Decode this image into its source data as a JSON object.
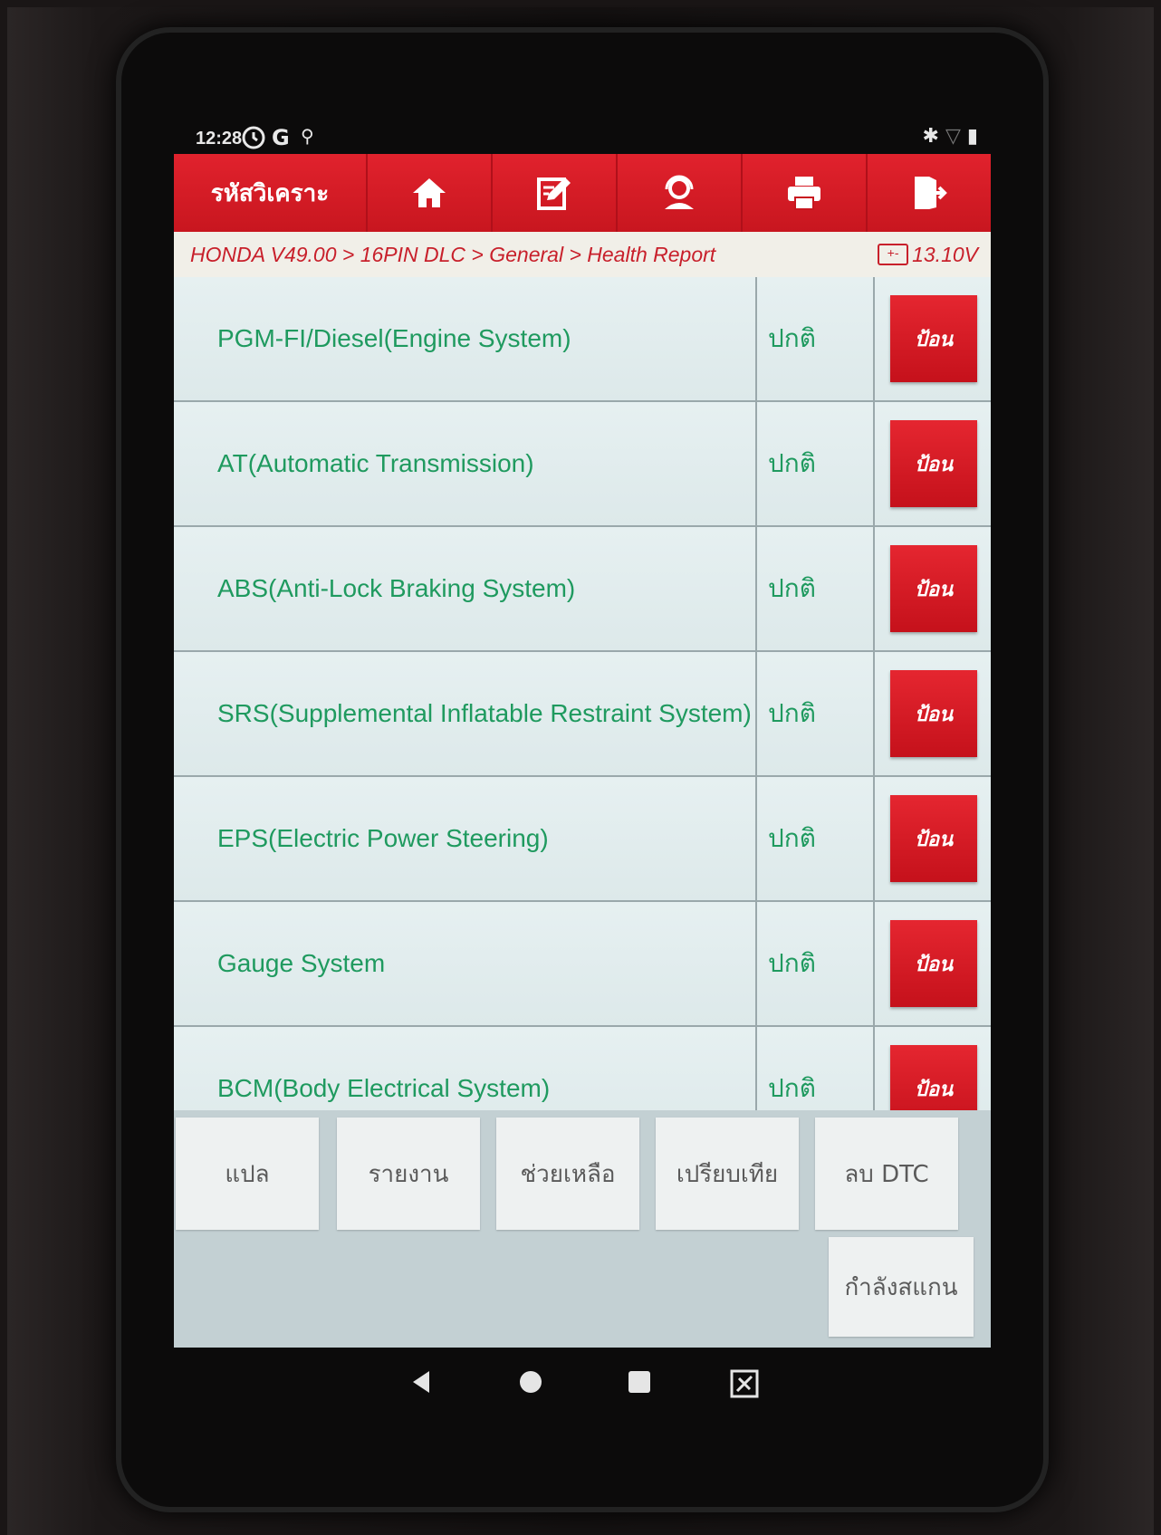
{
  "status_bar": {
    "time": "12:28",
    "icons": [
      "alarm-icon",
      "google-icon",
      "usb-debug-icon"
    ],
    "right_icons": [
      "bluetooth-icon",
      "wifi-icon",
      "battery-icon"
    ]
  },
  "toolbar": {
    "title": "รหัสวิเคราะ",
    "buttons": [
      "home-icon",
      "edit-icon",
      "support-icon",
      "print-icon",
      "exit-icon"
    ]
  },
  "breadcrumb": {
    "path": "HONDA V49.00 > 16PIN DLC > General > Health Report",
    "voltage": "13.10V"
  },
  "systems": [
    {
      "name": "PGM-FI/Diesel(Engine System)",
      "status": "ปกติ",
      "action": "ป้อน"
    },
    {
      "name": "AT(Automatic Transmission)",
      "status": "ปกติ",
      "action": "ป้อน"
    },
    {
      "name": "ABS(Anti-Lock Braking System)",
      "status": "ปกติ",
      "action": "ป้อน"
    },
    {
      "name": "SRS(Supplemental Inflatable Restraint System)",
      "status": "ปกติ",
      "action": "ป้อน"
    },
    {
      "name": "EPS(Electric Power Steering)",
      "status": "ปกติ",
      "action": "ป้อน"
    },
    {
      "name": "Gauge System",
      "status": "ปกติ",
      "action": "ป้อน"
    },
    {
      "name": "BCM(Body Electrical System)",
      "status": "ปกติ",
      "action": "ป้อน"
    }
  ],
  "footer": {
    "translate": "แปล",
    "report": "รายงาน",
    "help": "ช่วยเหลือ",
    "compare": "เปรียบเทีย",
    "clear_dtc": "ลบ DTC",
    "scanning": "กำลังสแกน"
  },
  "colors": {
    "toolbar_red": "#d81b25",
    "text_green": "#1f9a5f",
    "breadcrumb_red": "#c8202b"
  }
}
